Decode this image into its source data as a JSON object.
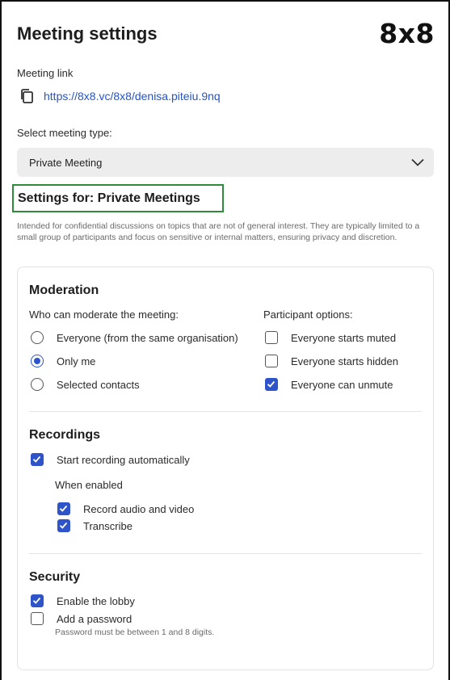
{
  "header": {
    "title": "Meeting settings",
    "logo_text": "8x8"
  },
  "meeting_link": {
    "label": "Meeting link",
    "url": "https://8x8.vc/8x8/denisa.piteiu.9nq",
    "copy_icon": "copy-icon"
  },
  "meeting_type": {
    "label": "Select meeting type:",
    "selected": "Private Meeting",
    "chevron_icon": "chevron-down-icon"
  },
  "settings": {
    "heading": "Settings for: Private Meetings",
    "description": "Intended for confidential discussions on topics that are not of general interest. They are typically limited to a small group of participants and focus on sensitive or internal matters, ensuring privacy and discretion."
  },
  "moderation": {
    "title": "Moderation",
    "moderate_label": "Who can moderate the meeting:",
    "moderate_options": [
      {
        "label": "Everyone (from the same organisation)",
        "selected": false
      },
      {
        "label": "Only me",
        "selected": true
      },
      {
        "label": "Selected contacts",
        "selected": false
      }
    ],
    "participant_label": "Participant options:",
    "participant_options": [
      {
        "label": "Everyone starts muted",
        "checked": false
      },
      {
        "label": "Everyone starts hidden",
        "checked": false
      },
      {
        "label": "Everyone can unmute",
        "checked": true
      }
    ]
  },
  "recordings": {
    "title": "Recordings",
    "auto_record": {
      "label": "Start recording automatically",
      "checked": true
    },
    "when_enabled_label": "When enabled",
    "sub_options": [
      {
        "label": "Record audio and video",
        "checked": true
      },
      {
        "label": "Transcribe",
        "checked": true
      }
    ]
  },
  "security": {
    "title": "Security",
    "lobby": {
      "label": "Enable the lobby",
      "checked": true
    },
    "password": {
      "label": "Add a password",
      "checked": false
    },
    "password_hint": "Password must be between 1 and 8 digits."
  },
  "colors": {
    "accent": "#2f54c9",
    "link": "#2554c7",
    "highlight_border": "#2e8b3a"
  }
}
